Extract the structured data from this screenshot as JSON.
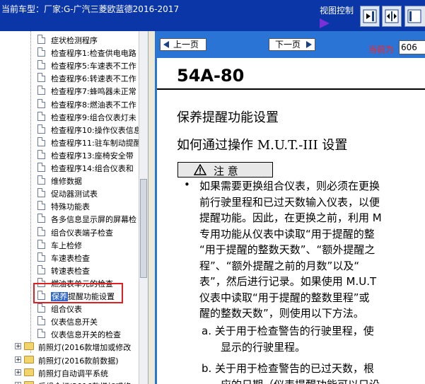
{
  "header": {
    "title": "当前车型：厂家:G-广汽三菱欧蓝德2016-2017",
    "view_control_label": "视图控制"
  },
  "tree": {
    "items": [
      {
        "label": "症状检测程序"
      },
      {
        "label": "检查程序1:检查供电电路"
      },
      {
        "label": "检查程序5:车速表不工作"
      },
      {
        "label": "检查程序6:转速表不工作"
      },
      {
        "label": "检查程序7:蜂鸣器未正常"
      },
      {
        "label": "检查程序8:燃油表不工作"
      },
      {
        "label": "检查程序9:组合仪表灯未"
      },
      {
        "label": "检查程序10:操作仪表信息"
      },
      {
        "label": "检查程序11:驻车制动提醒"
      },
      {
        "label": "检查程序13:座椅安全带"
      },
      {
        "label": "检查程序14:组合仪表和"
      },
      {
        "label": "维修数据"
      },
      {
        "label": "促动器测试表"
      },
      {
        "label": "特殊功能表"
      },
      {
        "label": "各多信息显示屏的屏幕检"
      },
      {
        "label": "组合仪表端子检查"
      },
      {
        "label": "车上检修"
      },
      {
        "label": "车速表检查"
      },
      {
        "label": "转速表检查"
      },
      {
        "label": "燃油表单元的检查"
      },
      {
        "label": "保养提醒功能设置",
        "highlight": "保养"
      },
      {
        "label": "组合仪表"
      },
      {
        "label": "仪表信息开关"
      },
      {
        "label": "仪表信息开关的检查"
      }
    ],
    "folders": [
      {
        "label": "前照灯(2016款增加或修改"
      },
      {
        "label": "前照灯(2016款前数据)"
      },
      {
        "label": "前照灯自动调平系统"
      },
      {
        "label": "后组合灯(2016款增加或修"
      }
    ]
  },
  "viewer": {
    "prev_label": "上一页",
    "next_label": "下一页",
    "current_label": "当前为",
    "current_page": "606"
  },
  "document": {
    "code": "54A-80",
    "heading1": "保养提醒功能设置",
    "heading2": "如何通过操作 M.U.T.-III 设置",
    "caution_label": "注 意",
    "bullet": "•",
    "lines": [
      "如果需要更换组合仪表，则必须在更换",
      "前行驶里程和已过天数输入仪表，以便",
      "提醒功能。因此，在更换之前，利用 M",
      "专用功能从仪表中读取“用于提醒的整",
      "“用于提醒的整数天数”、“额外提醒之",
      "程”、“额外提醒之前的月数”以及“",
      "表”，然后进行记录。如果使用 M.U.T",
      "仪表中读取“用于提醒的整数里程”或",
      "醒的整数天数”，则使用以下方法。"
    ],
    "sub_a": "a. 关于用于检查警告的行驶里程，使",
    "sub_a2": "显示的行驶里程。",
    "sub_b": "b. 关于用于检查警告的已过天数，根",
    "sub_b2": "应的日期（仪表提醒功能可以只设"
  }
}
